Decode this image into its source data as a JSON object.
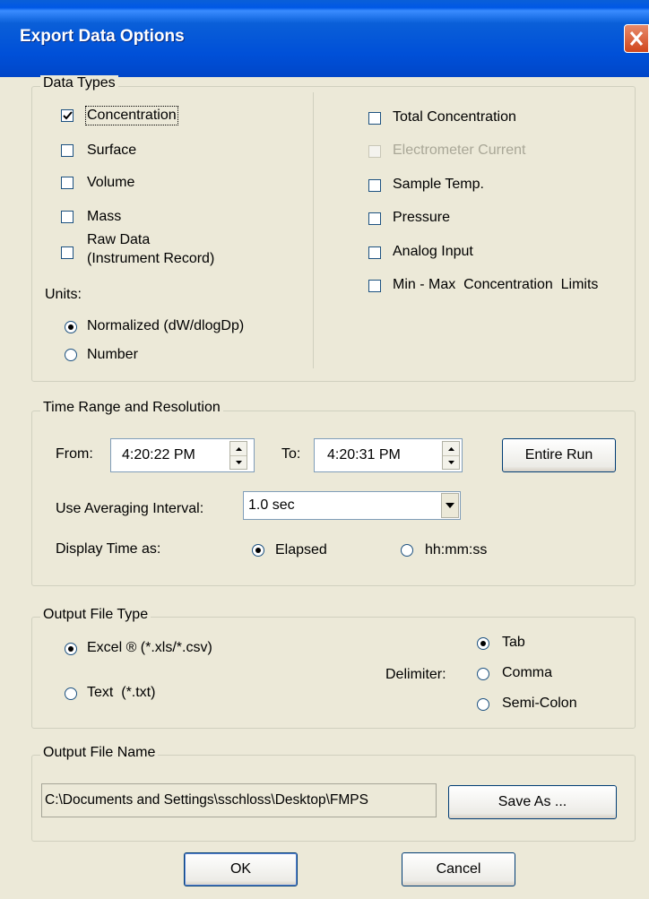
{
  "window": {
    "title": "Export Data Options"
  },
  "data_types": {
    "group_label": "Data Types",
    "left": [
      {
        "label": "Concentration",
        "checked": true
      },
      {
        "label": "Surface",
        "checked": false
      },
      {
        "label": "Volume",
        "checked": false
      },
      {
        "label": "Mass",
        "checked": false
      },
      {
        "label_line1": "Raw Data",
        "label_line2": "(Instrument Record)",
        "checked": false
      }
    ],
    "right": [
      {
        "label": "Total Concentration",
        "checked": false
      },
      {
        "label": "Electrometer Current",
        "checked": false,
        "disabled": true
      },
      {
        "label": "Sample Temp.",
        "checked": false
      },
      {
        "label": "Pressure",
        "checked": false
      },
      {
        "label": "Analog Input",
        "checked": false
      },
      {
        "label": "Min - Max  Concentration  Limits",
        "checked": false
      }
    ],
    "units_label": "Units:",
    "units": [
      {
        "label": "Normalized (dW/dlogDp)",
        "selected": true
      },
      {
        "label": "Number",
        "selected": false
      }
    ]
  },
  "time_range": {
    "group_label": "Time Range and Resolution",
    "from_label": "From:",
    "from_value": "4:20:22 PM",
    "to_label": "To:",
    "to_value": "4:20:31 PM",
    "entire_run_label": "Entire Run",
    "averaging_label": "Use Averaging Interval:",
    "averaging_value": "1.0 sec",
    "display_time_label": "Display Time as:",
    "display_options": [
      {
        "label": "Elapsed",
        "selected": true
      },
      {
        "label": "hh:mm:ss",
        "selected": false
      }
    ]
  },
  "output_type": {
    "group_label": "Output File Type",
    "types": [
      {
        "label": "Excel ® (*.xls/*.csv)",
        "selected": true
      },
      {
        "label": "Text  (*.txt)",
        "selected": false
      }
    ],
    "delimiter_label": "Delimiter:",
    "delimiters": [
      {
        "label": "Tab",
        "selected": true
      },
      {
        "label": "Comma",
        "selected": false
      },
      {
        "label": "Semi-Colon",
        "selected": false
      }
    ]
  },
  "output_name": {
    "group_label": "Output File Name",
    "path": "C:\\Documents and Settings\\sschloss\\Desktop\\FMPS",
    "save_as_label": "Save As ..."
  },
  "footer": {
    "ok_label": "OK",
    "cancel_label": "Cancel"
  }
}
